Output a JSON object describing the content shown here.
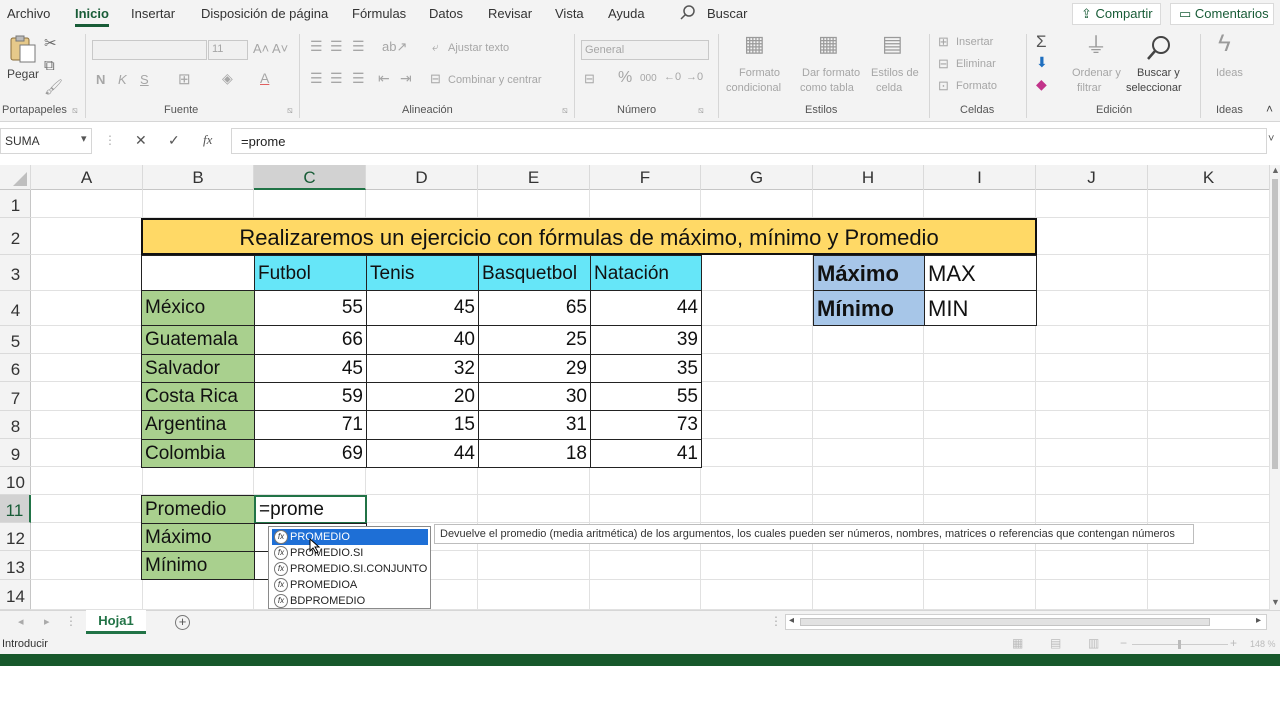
{
  "menu": {
    "items": [
      "Archivo",
      "Inicio",
      "Insertar",
      "Disposición de página",
      "Fórmulas",
      "Datos",
      "Revisar",
      "Vista",
      "Ayuda"
    ],
    "active": "Inicio",
    "search_label": "Buscar",
    "share_label": "Compartir",
    "comments_label": "Comentarios"
  },
  "ribbon": {
    "paste_label": "Pegar",
    "font_size": "11",
    "bold": "N",
    "italic": "K",
    "underline": "S",
    "wrap_text": "Ajustar texto",
    "merge_center": "Combinar y centrar",
    "number_format": "General",
    "cond_format": [
      "Formato",
      "condicional"
    ],
    "table_format": [
      "Dar formato",
      "como tabla"
    ],
    "cell_styles": [
      "Estilos de",
      "celda"
    ],
    "insert_label": "Insertar",
    "delete_label": "Eliminar",
    "format_label": "Formato",
    "sort_filter": [
      "Ordenar y",
      "filtrar"
    ],
    "find_select": [
      "Buscar y",
      "seleccionar"
    ],
    "ideas_label": "Ideas",
    "groups": {
      "clipboard": "Portapapeles",
      "font": "Fuente",
      "alignment": "Alineación",
      "number": "Número",
      "styles": "Estilos",
      "cells": "Celdas",
      "editing": "Edición",
      "ideas": "Ideas"
    }
  },
  "formula_bar": {
    "name_box": "SUMA",
    "cancel": "✕",
    "enter": "✓",
    "fx": "fx",
    "formula": "=prome"
  },
  "sheet": {
    "columns": [
      "A",
      "B",
      "C",
      "D",
      "E",
      "F",
      "G",
      "H",
      "I",
      "J",
      "K"
    ],
    "rows": [
      "1",
      "2",
      "3",
      "4",
      "5",
      "6",
      "7",
      "8",
      "9",
      "10",
      "11",
      "12",
      "13",
      "14"
    ],
    "title": "Realizaremos un ejercicio con fórmulas de máximo, mínimo y Promedio",
    "headers": [
      "Futbol",
      "Tenis",
      "Basquetbol",
      "Natación"
    ],
    "countries": [
      "México",
      "Guatemala",
      "Salvador",
      "Costa Rica",
      "Argentina",
      "Colombia"
    ],
    "values": [
      [
        55,
        45,
        65,
        44
      ],
      [
        66,
        40,
        25,
        39
      ],
      [
        45,
        32,
        29,
        35
      ],
      [
        59,
        20,
        30,
        55
      ],
      [
        71,
        15,
        31,
        73
      ],
      [
        69,
        44,
        18,
        41
      ]
    ],
    "stats_labels": [
      "Promedio",
      "Máximo",
      "Mínimo"
    ],
    "editing_value": "=prome",
    "side_table": [
      {
        "label": "Máximo",
        "value": "MAX"
      },
      {
        "label": "Mínimo",
        "value": "MIN"
      }
    ]
  },
  "autocomplete": {
    "items": [
      "PROMEDIO",
      "PROMEDIO.SI",
      "PROMEDIO.SI.CONJUNTO",
      "PROMEDIOA",
      "BDPROMEDIO"
    ],
    "selected_index": 0,
    "tooltip": "Devuelve el promedio (media aritmética) de los argumentos, los cuales pueden ser números, nombres, matrices o referencias que contengan números"
  },
  "tabs": {
    "sheets": [
      "Hoja1"
    ],
    "add": "+"
  },
  "status": {
    "mode": "Introducir",
    "zoom": "148 %"
  },
  "colors": {
    "accent": "#217346",
    "title_fill": "#ffd966",
    "country_fill": "#a9d08e",
    "header_fill": "#66e6f8",
    "side_label_fill": "#a7c6e8",
    "autocomplete_highlight": "#1e6fd6"
  }
}
